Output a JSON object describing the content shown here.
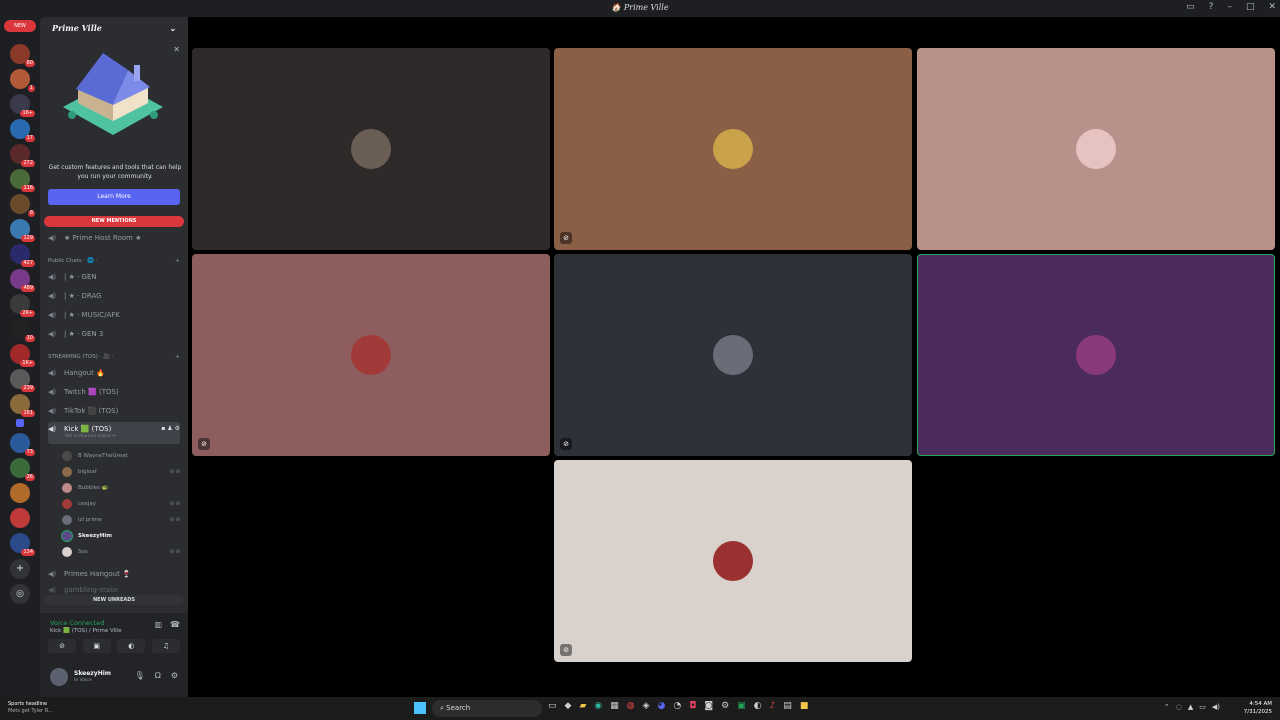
{
  "window": {
    "title": "🏠 Prime Ville"
  },
  "guilds": {
    "new_pill": "NEW",
    "badges": [
      "80",
      "1",
      "16+",
      "17",
      "272",
      "116",
      "8",
      "129",
      "427",
      "489",
      "2K+",
      "10",
      "1K+",
      "239",
      "161",
      "73",
      "26",
      "",
      "134"
    ]
  },
  "server": {
    "name": "Prime Ville",
    "promo": {
      "text": "Get custom features and tools that can help you run your community.",
      "button": "Learn More"
    },
    "new_mentions": "NEW MENTIONS",
    "new_unreads": "NEW UNREADS",
    "host_room": "★ Prime Host Room ★",
    "categories": {
      "public": "Public Chats · 🌐 ·",
      "streaming": "STREAMING (TOS) · 🎥 ·"
    },
    "public_channels": [
      "| ★ · GEN",
      "| ★ · DRAG",
      "| ★ · MUSIC/AFK",
      "| ★ · GEN 3"
    ],
    "streaming_channels": [
      "Hangout 🔥",
      "Twitch 🟪 (TOS)",
      "TikTok ⬛ (TOS)"
    ],
    "active_channel": {
      "name": "Kick 🟩 (TOS)",
      "status": "Set a channel status ✏"
    },
    "members": [
      "B WayneTheGreat",
      "bigloaf",
      "Bubbles 🐢",
      "ceejay",
      "lzl prime",
      "SkeezyHim",
      "Sos"
    ],
    "after_channels": [
      "Primes Hangout 🍷",
      "gambling-stake"
    ]
  },
  "voice": {
    "status": "Voice Connected",
    "channel": "Kick 🟩 (TOS) / Prime Ville"
  },
  "user": {
    "name": "SkeezyHim",
    "status": "In Voice"
  },
  "taskbar": {
    "news_title": "Sports headline",
    "news_sub": "Mets get Tyler R...",
    "search": "Search",
    "time": "4:54 AM",
    "date": "7/31/2025"
  },
  "tiles": [
    {
      "bg": "#2e2a29",
      "av": "#6b5f55"
    },
    {
      "bg": "#8a5f45",
      "av": "#c9a24a"
    },
    {
      "bg": "#b8918a",
      "av": "#e6c3c0"
    },
    {
      "bg": "#8e5e5f",
      "av": "#a33a3a"
    },
    {
      "bg": "#2f3139",
      "av": "#6a6d78"
    },
    {
      "bg": "#4b2a5e",
      "av": "#8a3a7a"
    },
    {
      "bg": "#d8d1cc",
      "av": "#9a3030"
    }
  ]
}
